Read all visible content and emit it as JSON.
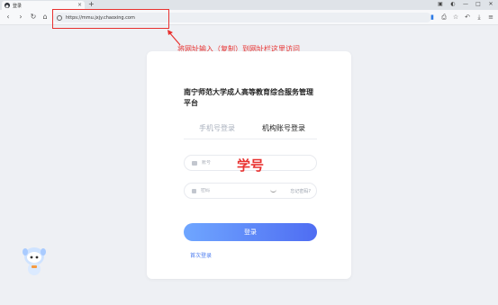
{
  "browser": {
    "tab_title": "登录",
    "tab_close": "×",
    "new_tab": "+",
    "url": "https://mmu.jxjy.chaoxing.com"
  },
  "annotation": {
    "instruction": "将网址输入（复制）到网址栏这里访问",
    "field_label": "学号",
    "color": "#e8312f"
  },
  "login": {
    "title": "南宁师范大学成人高等教育综合服务管理平台",
    "tab_phone": "手机号登录",
    "tab_org": "机构账号登录",
    "account_placeholder": "账号",
    "password_placeholder": "密码",
    "forgot": "忘记密码?",
    "submit": "登录",
    "first_login": "首次登录",
    "accent": "#4e7ef0"
  }
}
